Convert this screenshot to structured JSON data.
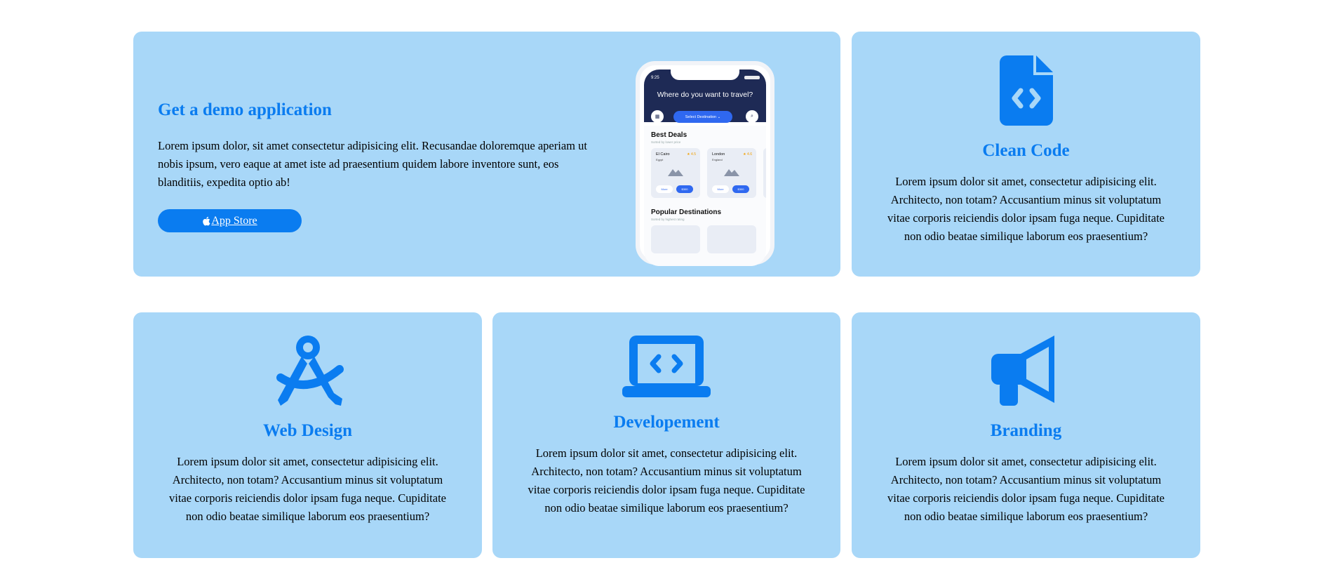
{
  "demo": {
    "title": "Get a demo application",
    "text": "Lorem ipsum dolor, sit amet consectetur adipisicing elit. Recusandae doloremque aperiam ut nobis ipsum, vero eaque at amet iste ad praesentium quidem labore inventore sunt, eos blanditiis, expedita optio ab!",
    "store_button": "App Store",
    "phone": {
      "time": "9:25",
      "question": "Where do you want to travel?",
      "select_label": "Select Destination",
      "best_deals": "Best Deals",
      "best_deals_sub": "Sorted by lower price",
      "popular": "Popular Destinations",
      "popular_sub": "Sorted by highest rating",
      "deals": [
        {
          "city": "El Cairo",
          "country": "Egypt",
          "rating": "★ 4.5",
          "more": "More",
          "price": "$300"
        },
        {
          "city": "London",
          "country": "England",
          "rating": "★ 4.6",
          "more": "More",
          "price": "$300"
        }
      ]
    }
  },
  "clean_code": {
    "icon": "file-code-icon",
    "title": "Clean Code",
    "text": "Lorem ipsum dolor sit amet, consectetur adipisicing elit. Architecto, non totam? Accusantium minus sit voluptatum vitae corporis reiciendis dolor ipsam fuga neque. Cupiditate non odio beatae similique laborum eos praesentium?"
  },
  "web_design": {
    "icon": "compass-drafting-icon",
    "title": "Web Design",
    "text": "Lorem ipsum dolor sit amet, consectetur adipisicing elit. Architecto, non totam? Accusantium minus sit voluptatum vitae corporis reiciendis dolor ipsam fuga neque. Cupiditate non odio beatae similique laborum eos praesentium?"
  },
  "development": {
    "icon": "laptop-code-icon",
    "title": "Developement",
    "text": "Lorem ipsum dolor sit amet, consectetur adipisicing elit. Architecto, non totam? Accusantium minus sit voluptatum vitae corporis reiciendis dolor ipsam fuga neque. Cupiditate non odio beatae similique laborum eos praesentium?"
  },
  "branding": {
    "icon": "bullhorn-icon",
    "title": "Branding",
    "text": "Lorem ipsum dolor sit amet, consectetur adipisicing elit. Architecto, non totam? Accusantium minus sit voluptatum vitae corporis reiciendis dolor ipsam fuga neque. Cupiditate non odio beatae similique laborum eos praesentium?"
  },
  "colors": {
    "card_bg": "#a8d7f8",
    "accent": "#0a7cf0"
  }
}
